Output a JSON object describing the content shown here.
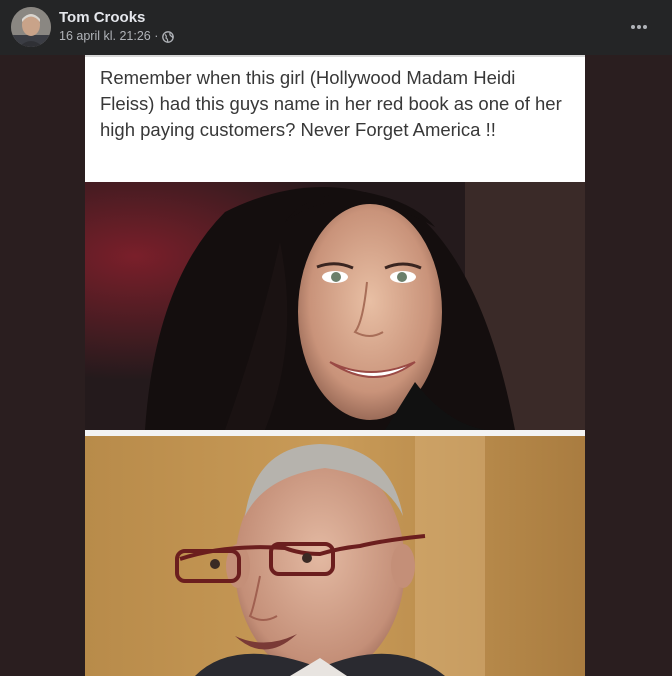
{
  "post": {
    "author_name": "Tom Crooks",
    "timestamp": "16 april kl. 21:26 ·",
    "privacy_icon": "globe-icon",
    "more_icon": "more-options-icon"
  },
  "image": {
    "caption": "Remember when this girl (Hollywood Madam Heidi Fleiss) had this guys name in her red book as one of her high paying customers? Never Forget America !!"
  },
  "colors": {
    "header_bg": "#242526",
    "media_bg": "#2a1e1f",
    "author_text": "#e4e6eb",
    "meta_text": "#b0b3b8"
  }
}
